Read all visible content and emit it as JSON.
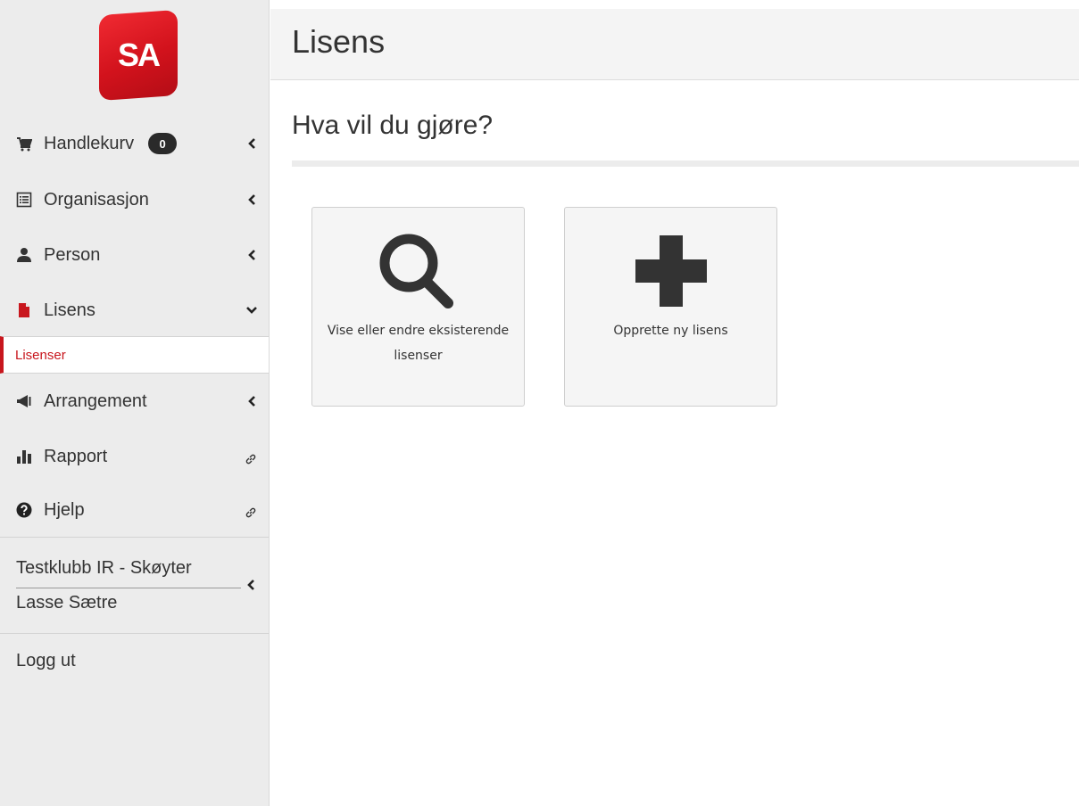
{
  "logo": {
    "text": "SA"
  },
  "sidebar": {
    "items": [
      {
        "label": "Handlekurv",
        "icon": "cart-icon",
        "badge": "0"
      },
      {
        "label": "Organisasjon",
        "icon": "list-icon"
      },
      {
        "label": "Person",
        "icon": "user-icon"
      },
      {
        "label": "Lisens",
        "icon": "file-icon",
        "expanded": true
      },
      {
        "label": "Arrangement",
        "icon": "bullhorn-icon"
      },
      {
        "label": "Rapport",
        "icon": "bar-chart-icon"
      },
      {
        "label": "Hjelp",
        "icon": "question-circle-icon"
      }
    ],
    "subitem": {
      "label": "Lisenser"
    },
    "org_name": "Testklubb IR - Skøyter",
    "user_name": "Lasse Sætre",
    "logout": "Logg ut"
  },
  "header": {
    "title": "Lisens"
  },
  "main": {
    "question": "Hva vil du gjøre?",
    "cards": [
      {
        "label": "Vise eller endre eksisterende lisenser",
        "icon": "search-icon"
      },
      {
        "label": "Opprette ny lisens",
        "icon": "plus-icon"
      }
    ]
  },
  "colors": {
    "accent": "#c8161d",
    "sidebar_bg": "#ececec",
    "badge_bg": "#2a2a2a"
  }
}
